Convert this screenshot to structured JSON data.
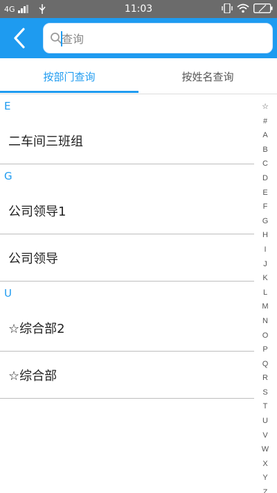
{
  "status_bar": {
    "network": "4G",
    "time": "11:03"
  },
  "header": {
    "back_icon": "chevron-left-icon",
    "search_placeholder": "查询",
    "search_value": ""
  },
  "tabs": [
    {
      "label": "按部门查询",
      "active": true
    },
    {
      "label": "按姓名查询",
      "active": false
    }
  ],
  "sections": [
    {
      "letter": "E",
      "items": [
        "二车间三班组"
      ]
    },
    {
      "letter": "G",
      "items": [
        "公司领导1",
        "公司领导"
      ]
    },
    {
      "letter": "U",
      "items": [
        "☆综合部2",
        "☆综合部"
      ]
    }
  ],
  "index_letters": [
    "☆",
    "#",
    "A",
    "B",
    "C",
    "D",
    "E",
    "F",
    "G",
    "H",
    "I",
    "J",
    "K",
    "L",
    "M",
    "N",
    "O",
    "P",
    "Q",
    "R",
    "S",
    "T",
    "U",
    "V",
    "W",
    "X",
    "Y",
    "Z"
  ],
  "colors": {
    "accent": "#1e9bf0",
    "status_bar": "#6b6b6b"
  }
}
